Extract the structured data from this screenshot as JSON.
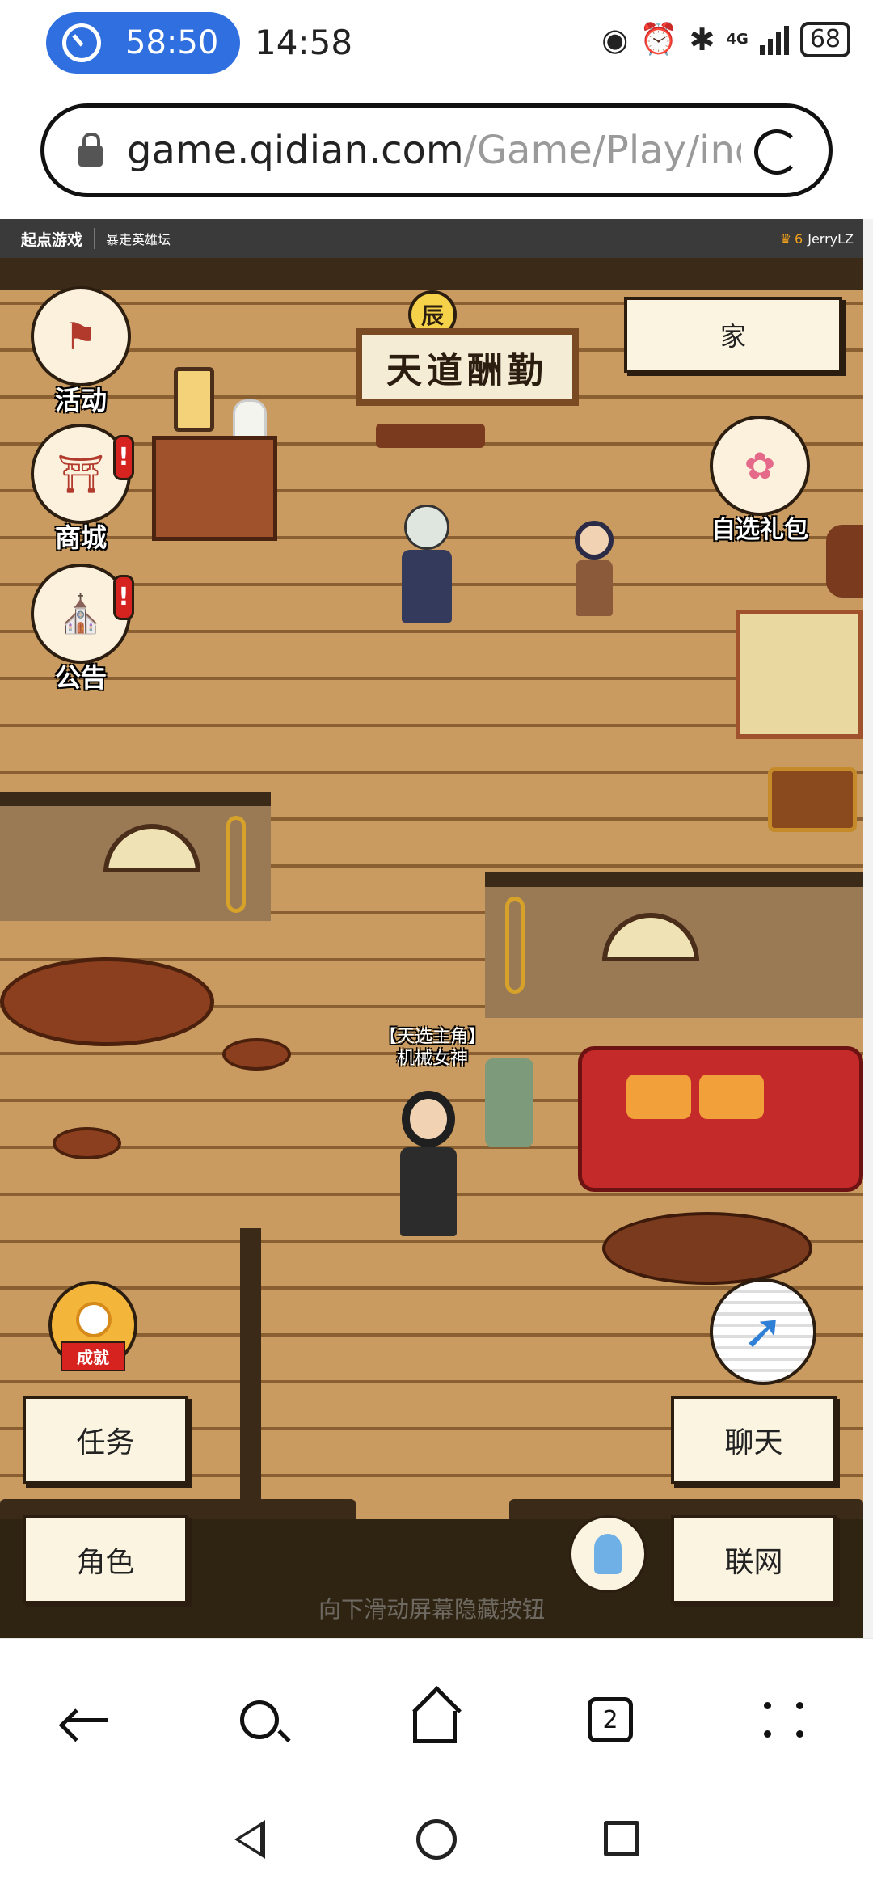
{
  "status_bar": {
    "timer": "58:50",
    "time": "14:58",
    "network": "4G",
    "battery": "68"
  },
  "browser": {
    "url_domain": "game.qidian.com",
    "url_path": "/Game/Play/inde",
    "tab_count": "2"
  },
  "game_header": {
    "logo": "起点游戏",
    "game_name": "暴走英雄坛",
    "vip_level": "6",
    "username": "JerryLZ"
  },
  "scene": {
    "time_badge": "辰",
    "sign": "天道酬勤",
    "home_label": "家",
    "npc_title": "【天选主角】",
    "npc_name": "机械女神",
    "hint": "向下滑动屏幕隐藏按钮"
  },
  "menu": {
    "activity": "活动",
    "shop": "商城",
    "notice": "公告",
    "gift": "自选礼包",
    "achievement": "成就",
    "alert_mark": "!"
  },
  "buttons": {
    "quest": "任务",
    "character": "角色",
    "chat": "聊天",
    "online": "联网"
  },
  "icons": {
    "timer": "timer-icon",
    "lock": "lock-icon",
    "reload": "reload-icon",
    "back": "back-arrow-icon",
    "search": "search-icon",
    "home": "home-icon",
    "tabs": "tabs-icon",
    "more": "more-icon",
    "run": "run-icon",
    "meditate": "meditate-icon"
  },
  "colors": {
    "timer_pill": "#2f6fe0",
    "alert": "#d6231f",
    "floor": "#c99b60",
    "button_bg": "#fbf4e1"
  }
}
